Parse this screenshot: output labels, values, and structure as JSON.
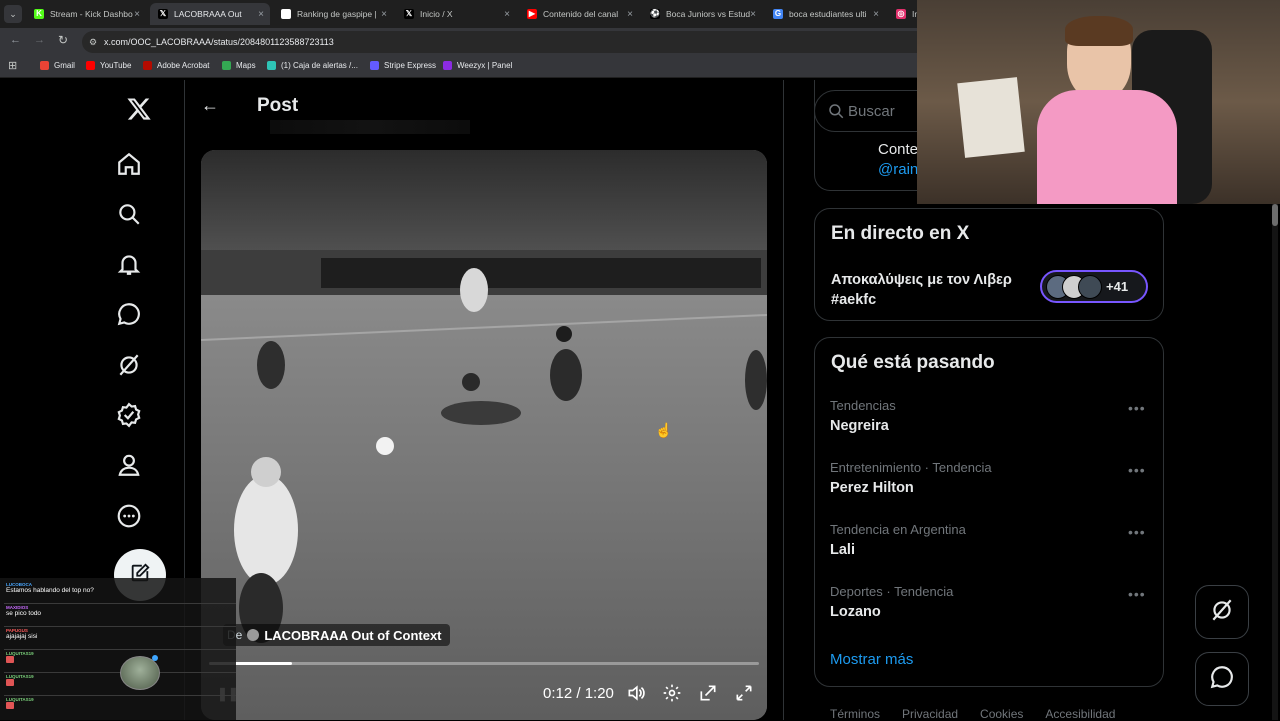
{
  "browser": {
    "tabs": [
      {
        "title": "Stream - Kick Dashbo",
        "fav_color": "#53fc18",
        "fav_char": "K"
      },
      {
        "title": "LACOBRAAA Out",
        "fav_color": "#000000",
        "fav_char": "𝕏",
        "active": true
      },
      {
        "title": "Ranking de gaspipe |",
        "fav_color": "#ffffff",
        "fav_char": "◆"
      },
      {
        "title": "Inicio / X",
        "fav_color": "#000000",
        "fav_char": "𝕏"
      },
      {
        "title": "Contenido del canal",
        "fav_color": "#ff0000",
        "fav_char": "▶"
      },
      {
        "title": "Boca Juniors vs Estud",
        "fav_color": "#000000",
        "fav_char": "⚽"
      },
      {
        "title": "boca estudiantes ulti",
        "fav_color": "#4285f4",
        "fav_char": "G"
      },
      {
        "title": "Ins",
        "fav_color": "#e1306c",
        "fav_char": "◎"
      }
    ],
    "url": "x.com/OOC_LACOBRAAA/status/2084801123588723113",
    "bookmarks": [
      {
        "label": "Gmail",
        "color": "#ea4335"
      },
      {
        "label": "YouTube",
        "color": "#ff0000"
      },
      {
        "label": "Adobe Acrobat",
        "color": "#b30b00"
      },
      {
        "label": "Maps",
        "color": "#34a853"
      },
      {
        "label": "(1) Caja de alertas /...",
        "color": "#2ec4b6"
      },
      {
        "label": "Stripe Express",
        "color": "#635bff"
      },
      {
        "label": "Weezyx | Panel",
        "color": "#8b2be2"
      }
    ]
  },
  "nav": {
    "icons": [
      "x-logo-icon",
      "home-icon",
      "search-icon",
      "notifications-icon",
      "messages-icon",
      "grok-icon",
      "verified-icon",
      "profile-icon",
      "more-icon"
    ]
  },
  "post": {
    "header_title": "Post",
    "video": {
      "author_prefix": "De",
      "author_name": "LACOBRAAA Out of Context",
      "time": "0:12 / 1:20",
      "progress": 0.15
    }
  },
  "sidebar": {
    "search_placeholder": "Buscar",
    "partial_card": {
      "line1": "Conte",
      "line2": "@rain"
    },
    "live": {
      "heading": "En directo en X",
      "title_line1": "Αποκαλύψεις με τον Λιβερ",
      "title_line2": "#aekfc",
      "count": "+41"
    },
    "trends": {
      "heading": "Qué está pasando",
      "items": [
        {
          "context": "Tendencias",
          "name": "Negreira"
        },
        {
          "context": "Entretenimiento · Tendencia",
          "name": "Perez Hilton"
        },
        {
          "context": "Tendencia en Argentina",
          "name": "Lali"
        },
        {
          "context": "Deportes · Tendencia",
          "name": "Lozano"
        }
      ],
      "show_more": "Mostrar más"
    },
    "footer": [
      "Términos",
      "Privacidad",
      "Cookies",
      "Accesibilidad"
    ]
  },
  "chat": {
    "messages": [
      {
        "user": "LUCOBOCA",
        "text": "Estamos hablando del top no?",
        "color": "#4aa8ff"
      },
      {
        "user": "MAXIDIOS",
        "text": "se pico todo",
        "color": "#c96cff"
      },
      {
        "user": "PAPUGUS",
        "text": "ajajajaj sisi",
        "color": "#ff5a5a"
      },
      {
        "user": "LUQUITAS19",
        "text": "",
        "color": "#7bd17b"
      },
      {
        "user": "LUQUITAS19",
        "text": "",
        "color": "#7bd17b"
      },
      {
        "user": "LUQUITAS19",
        "text": "",
        "color": "#7bd17b"
      }
    ]
  },
  "colors": {
    "accent": "#1d9bf0",
    "live_border": "#7856ff"
  }
}
